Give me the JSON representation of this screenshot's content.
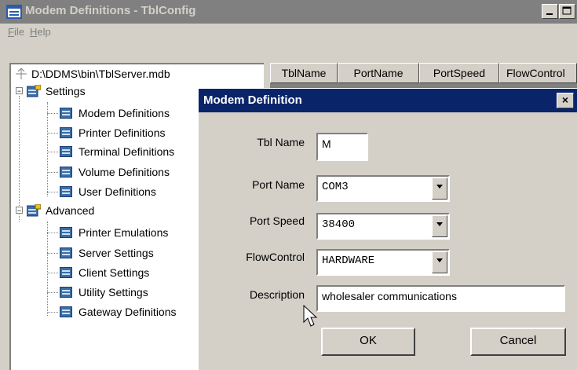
{
  "window": {
    "title": "Modem Definitions - TblConfig"
  },
  "menu": {
    "items": [
      "File",
      "Help"
    ]
  },
  "tree": {
    "root_path": "D:\\DDMS\\bin\\TblServer.mdb",
    "groups": [
      {
        "label": "Settings",
        "items": [
          "Modem Definitions",
          "Printer Definitions",
          "Terminal Definitions",
          "Volume Definitions",
          "User Definitions"
        ]
      },
      {
        "label": "Advanced",
        "items": [
          "Printer Emulations",
          "Server Settings",
          "Client Settings",
          "Utility Settings",
          "Gateway Definitions"
        ]
      }
    ]
  },
  "grid": {
    "columns": [
      "TblName",
      "PortName",
      "PortSpeed",
      "FlowControl"
    ]
  },
  "dialog": {
    "title": "Modem Definition",
    "close_glyph": "×",
    "fields": {
      "tbl_name": {
        "label": "Tbl Name",
        "value": "M"
      },
      "port_name": {
        "label": "Port Name",
        "value": "COM3"
      },
      "port_speed": {
        "label": "Port Speed",
        "value": "38400"
      },
      "flow_control": {
        "label": "FlowControl",
        "value": "HARDWARE"
      },
      "description": {
        "label": "Description",
        "value": "wholesaler communications"
      }
    },
    "ok_label": "OK",
    "cancel_label": "Cancel"
  },
  "colors": {
    "dialog_title_bg": "#0a246a",
    "inactive_title_bg": "#808080",
    "face": "#d4d0c8"
  }
}
